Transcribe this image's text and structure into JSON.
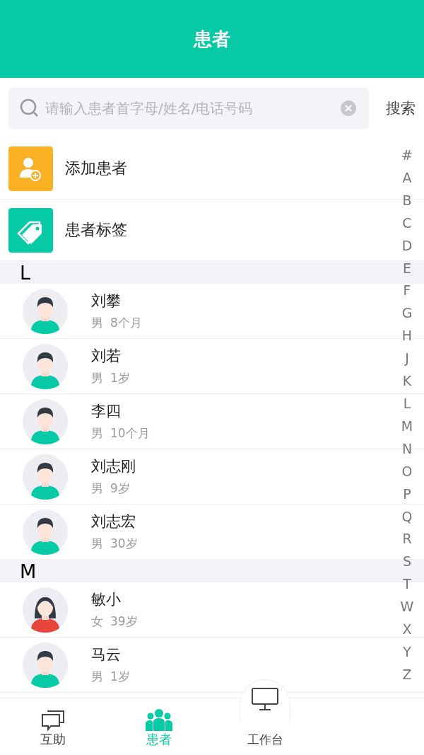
{
  "header": {
    "title": "患者"
  },
  "search": {
    "placeholder": "请输入患者首字母/姓名/电话号码",
    "button": "搜索"
  },
  "actions": [
    {
      "kind": "add",
      "label": "添加患者"
    },
    {
      "kind": "tag",
      "label": "患者标签"
    }
  ],
  "sections": [
    {
      "letter": "L",
      "patients": [
        {
          "name": "刘攀",
          "sex": "男",
          "age": "8个月",
          "kind": "male"
        },
        {
          "name": "刘若",
          "sex": "男",
          "age": "1岁",
          "kind": "male"
        },
        {
          "name": "李四",
          "sex": "男",
          "age": "10个月",
          "kind": "male"
        },
        {
          "name": "刘志刚",
          "sex": "男",
          "age": "9岁",
          "kind": "male"
        },
        {
          "name": "刘志宏",
          "sex": "男",
          "age": "30岁",
          "kind": "male"
        }
      ]
    },
    {
      "letter": "M",
      "patients": [
        {
          "name": "敏小",
          "sex": "女",
          "age": "39岁",
          "kind": "female"
        },
        {
          "name": "马云",
          "sex": "男",
          "age": "1岁",
          "kind": "male"
        }
      ]
    }
  ],
  "index": [
    "#",
    "A",
    "B",
    "C",
    "D",
    "E",
    "F",
    "G",
    "H",
    "J",
    "K",
    "L",
    "M",
    "N",
    "O",
    "P",
    "Q",
    "R",
    "S",
    "T",
    "W",
    "X",
    "Y",
    "Z"
  ],
  "tabs": [
    {
      "kind": "chat",
      "label": "互助",
      "selected": false
    },
    {
      "kind": "people",
      "label": "患者",
      "selected": true
    },
    {
      "kind": "desk",
      "label": "工作台",
      "selected": false
    }
  ]
}
